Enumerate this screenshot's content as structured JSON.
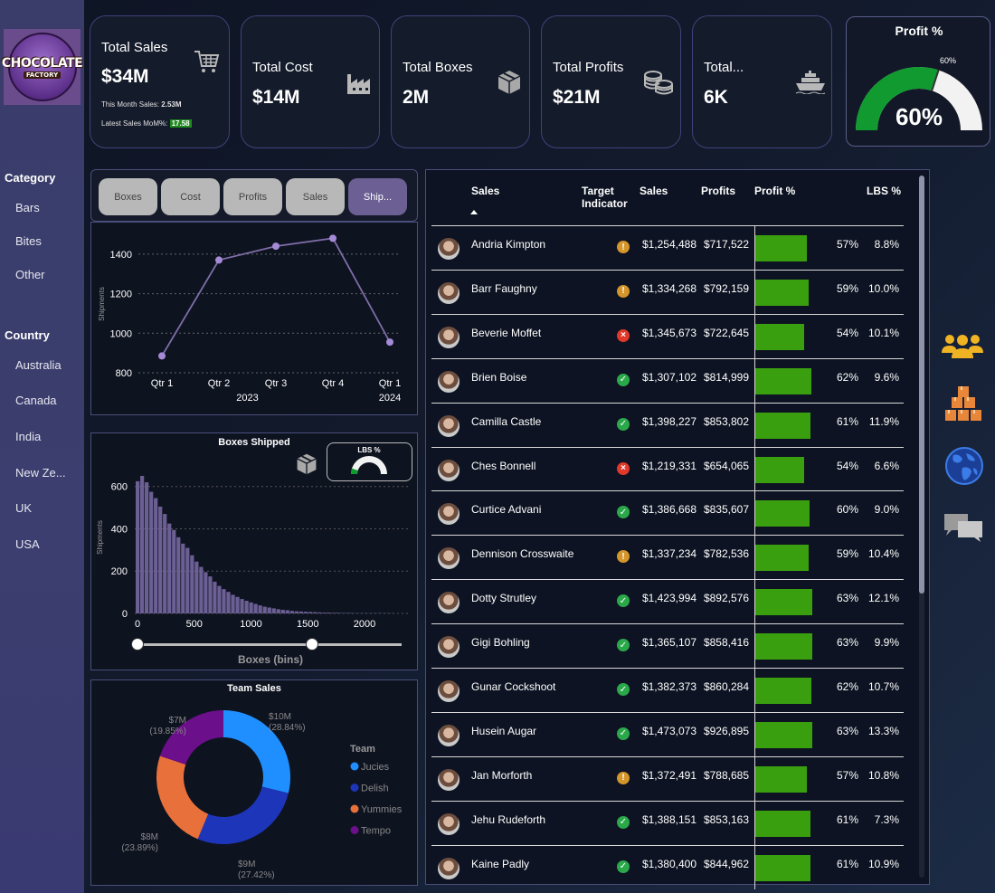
{
  "logo": {
    "line1": "CHOCOLATE",
    "line2": "FACTORY"
  },
  "sidebar": {
    "category_title": "Category",
    "categories": [
      "Bars",
      "Bites",
      "Other"
    ],
    "country_title": "Country",
    "countries": [
      "Australia",
      "Canada",
      "India",
      "New Ze...",
      "UK",
      "USA"
    ]
  },
  "kpis": {
    "total_sales": {
      "title": "Total Sales",
      "value": "$34M",
      "this_month_label": "This Month Sales:",
      "this_month_value": "2.53M",
      "mom_label": "Latest Sales MoM%:",
      "mom_value": "17.58",
      "icon": "cart-icon"
    },
    "total_cost": {
      "title": "Total Cost",
      "value": "$14M",
      "icon": "factory-icon"
    },
    "total_boxes": {
      "title": "Total Boxes",
      "value": "2M",
      "icon": "box-icon"
    },
    "total_profits": {
      "title": "Total Profits",
      "value": "$21M",
      "icon": "coins-icon"
    },
    "total_shipments": {
      "title": "Total...",
      "value": "6K",
      "icon": "ship-icon"
    }
  },
  "profit_gauge": {
    "title": "Profit %",
    "value_label": "60%",
    "target_label": "60%",
    "fraction": 0.6
  },
  "tabs": [
    {
      "label": "Boxes",
      "active": false
    },
    {
      "label": "Cost",
      "active": false
    },
    {
      "label": "Profits",
      "active": false
    },
    {
      "label": "Sales",
      "active": false
    },
    {
      "label": "Ship...",
      "active": true
    }
  ],
  "table": {
    "headers": {
      "name": "Sales",
      "target_line1": "Target",
      "target_line2": "Indicator",
      "sales": "Sales",
      "profits": "Profits",
      "profit_pct": "Profit %",
      "lbs_pct": "LBS %"
    },
    "rows": [
      {
        "name": "Andria Kimpton",
        "indicator": "warning",
        "sales": "$1,254,488",
        "profits": "$717,522",
        "profit_pct": "57%",
        "lbs": "8.8%",
        "pct": 57
      },
      {
        "name": "Barr Faughny",
        "indicator": "warning",
        "sales": "$1,334,268",
        "profits": "$792,159",
        "profit_pct": "59%",
        "lbs": "10.0%",
        "pct": 59
      },
      {
        "name": "Beverie Moffet",
        "indicator": "bad",
        "sales": "$1,345,673",
        "profits": "$722,645",
        "profit_pct": "54%",
        "lbs": "10.1%",
        "pct": 54
      },
      {
        "name": "Brien Boise",
        "indicator": "good",
        "sales": "$1,307,102",
        "profits": "$814,999",
        "profit_pct": "62%",
        "lbs": "9.6%",
        "pct": 62
      },
      {
        "name": "Camilla Castle",
        "indicator": "good",
        "sales": "$1,398,227",
        "profits": "$853,802",
        "profit_pct": "61%",
        "lbs": "11.9%",
        "pct": 61
      },
      {
        "name": "Ches Bonnell",
        "indicator": "bad",
        "sales": "$1,219,331",
        "profits": "$654,065",
        "profit_pct": "54%",
        "lbs": "6.6%",
        "pct": 54
      },
      {
        "name": "Curtice Advani",
        "indicator": "good",
        "sales": "$1,386,668",
        "profits": "$835,607",
        "profit_pct": "60%",
        "lbs": "9.0%",
        "pct": 60
      },
      {
        "name": "Dennison Crosswaite",
        "indicator": "warning",
        "sales": "$1,337,234",
        "profits": "$782,536",
        "profit_pct": "59%",
        "lbs": "10.4%",
        "pct": 59
      },
      {
        "name": "Dotty Strutley",
        "indicator": "good",
        "sales": "$1,423,994",
        "profits": "$892,576",
        "profit_pct": "63%",
        "lbs": "12.1%",
        "pct": 63
      },
      {
        "name": "Gigi Bohling",
        "indicator": "good",
        "sales": "$1,365,107",
        "profits": "$858,416",
        "profit_pct": "63%",
        "lbs": "9.9%",
        "pct": 63
      },
      {
        "name": "Gunar Cockshoot",
        "indicator": "good",
        "sales": "$1,382,373",
        "profits": "$860,284",
        "profit_pct": "62%",
        "lbs": "10.7%",
        "pct": 62
      },
      {
        "name": "Husein Augar",
        "indicator": "good",
        "sales": "$1,473,073",
        "profits": "$926,895",
        "profit_pct": "63%",
        "lbs": "13.3%",
        "pct": 63
      },
      {
        "name": "Jan Morforth",
        "indicator": "warning",
        "sales": "$1,372,491",
        "profits": "$788,685",
        "profit_pct": "57%",
        "lbs": "10.8%",
        "pct": 57
      },
      {
        "name": "Jehu Rudeforth",
        "indicator": "good",
        "sales": "$1,388,151",
        "profits": "$853,163",
        "profit_pct": "61%",
        "lbs": "7.3%",
        "pct": 61
      },
      {
        "name": "Kaine Padly",
        "indicator": "good",
        "sales": "$1,380,400",
        "profits": "$844,962",
        "profit_pct": "61%",
        "lbs": "10.9%",
        "pct": 61
      }
    ]
  },
  "histogram_extra": {
    "lbs_title": "LBS %",
    "lbs_value": "10.2%",
    "lbs_fraction": 0.102
  },
  "colors": {
    "accent": "#6b5f94",
    "good": "#3a9f0f",
    "warning": "#d4952a",
    "bad": "#e0392b",
    "ok_icon": "#2aa84a"
  },
  "right_icons": [
    "people-icon",
    "boxes-stack-icon",
    "globe-icon",
    "chat-icon"
  ],
  "chart_data": [
    {
      "type": "line",
      "title": "",
      "categories": [
        "Qtr 1",
        "Qtr 2",
        "Qtr 3",
        "Qtr 4",
        "Qtr 1"
      ],
      "groups": [
        "2023",
        "2024"
      ],
      "values": [
        885,
        1370,
        1440,
        1480,
        955
      ],
      "ylabel": "Shipments",
      "ylim": [
        800,
        1500
      ],
      "yticks": [
        800,
        1000,
        1200,
        1400
      ],
      "grid": true
    },
    {
      "type": "bar",
      "title": "Boxes Shipped",
      "xlabel": "Boxes (bins)",
      "ylabel": "Shipments",
      "ylim": [
        0,
        680
      ],
      "yticks": [
        0,
        200,
        400,
        600
      ],
      "xticks": [
        0,
        500,
        1000,
        1500,
        2000
      ],
      "bin_width": 40,
      "values": [
        625,
        650,
        620,
        575,
        545,
        505,
        470,
        425,
        395,
        360,
        330,
        310,
        275,
        245,
        220,
        195,
        175,
        150,
        130,
        115,
        102,
        88,
        78,
        68,
        60,
        52,
        45,
        38,
        32,
        28,
        24,
        20,
        17,
        15,
        12,
        10,
        9,
        8,
        7,
        6,
        5,
        4,
        4,
        3,
        3,
        2,
        2,
        2,
        1,
        1,
        1,
        1,
        1,
        1,
        1,
        1,
        1
      ],
      "grid": true
    },
    {
      "type": "pie",
      "title": "Team Sales",
      "legend_title": "Team",
      "legend_position": "right",
      "series": [
        {
          "name": "Jucies",
          "value": 28.84,
          "label": "$10M",
          "pct_label": "(28.84%)",
          "color": "#1f8fff"
        },
        {
          "name": "Delish",
          "value": 27.42,
          "label": "$9M",
          "pct_label": "(27.42%)",
          "color": "#1d35b8"
        },
        {
          "name": "Yummies",
          "value": 23.89,
          "label": "$8M",
          "pct_label": "(23.89%)",
          "color": "#e8703a"
        },
        {
          "name": "Tempo",
          "value": 19.85,
          "label": "$7M",
          "pct_label": "(19.85%)",
          "color": "#6b0f8a"
        }
      ]
    }
  ]
}
